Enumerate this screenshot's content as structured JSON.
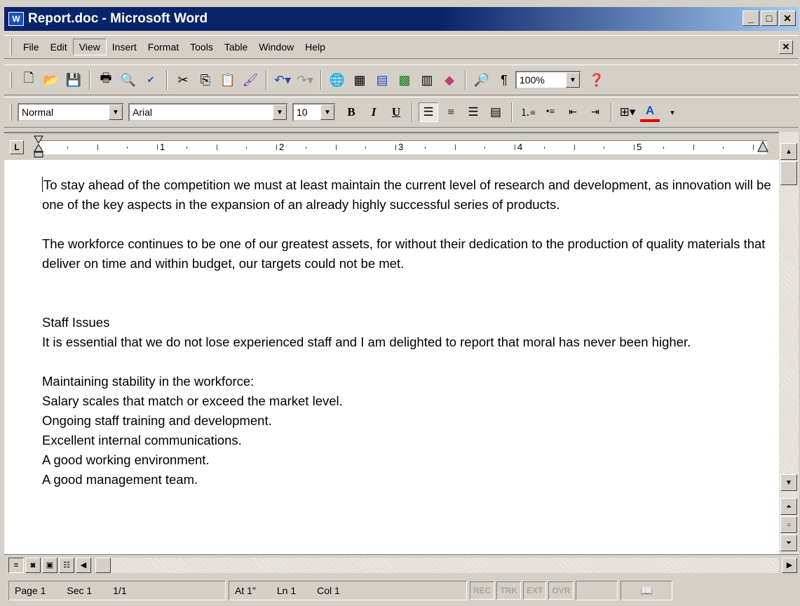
{
  "window": {
    "title": "Report.doc - Microsoft Word",
    "app_icon_glyph": "W",
    "controls": {
      "minimize": "_",
      "restore": "□",
      "close": "✕"
    }
  },
  "menu": {
    "items": [
      "File",
      "Edit",
      "View",
      "Insert",
      "Format",
      "Tools",
      "Table",
      "Window",
      "Help"
    ],
    "active": "View",
    "doc_close": "✕"
  },
  "standard_toolbar": {
    "zoom_value": "100%",
    "icons": [
      "new-icon",
      "open-icon",
      "save-icon",
      "print-icon",
      "print-preview-icon",
      "spelling-icon",
      "cut-icon",
      "copy-icon",
      "paste-icon",
      "format-painter-icon",
      "undo-icon",
      "redo-icon",
      "hyperlink-icon",
      "tables-borders-icon",
      "insert-table-icon",
      "insert-excel-icon",
      "columns-icon",
      "drawing-icon",
      "document-map-icon",
      "show-hide-icon",
      "help-icon"
    ]
  },
  "formatting_toolbar": {
    "style_value": "Normal",
    "font_value": "Arial",
    "size_value": "10",
    "bold": "B",
    "italic": "I",
    "underline": "U"
  },
  "ruler": {
    "numbers": [
      "1",
      "2",
      "3",
      "4",
      "5"
    ],
    "tab_stop": "L"
  },
  "document": {
    "para1": "To stay ahead of the competition we must at least maintain the current level of research and development, as innovation will be one of the key aspects in the expansion of an already highly successful series of products.",
    "para2": "The workforce continues to be one of our greatest assets, for without their dedication to the production of quality materials that deliver on time and within budget, our targets could not be met.",
    "heading": "Staff Issues",
    "para3": "It is essential that we do not lose experienced staff and I am delighted to report that moral has never been higher.",
    "list_intro": "Maintaining stability in the workforce:",
    "list_items": [
      "Salary scales that match or exceed the market level.",
      "Ongoing staff training and development.",
      "Excellent internal communications.",
      "A good working environment.",
      "A good management team."
    ]
  },
  "status": {
    "page": "Page 1",
    "section": "Sec 1",
    "pages": "1/1",
    "at": "At 1\"",
    "line": "Ln 1",
    "col": "Col 1",
    "rec": "REC",
    "trk": "TRK",
    "ext": "EXT",
    "ovr": "OVR"
  }
}
